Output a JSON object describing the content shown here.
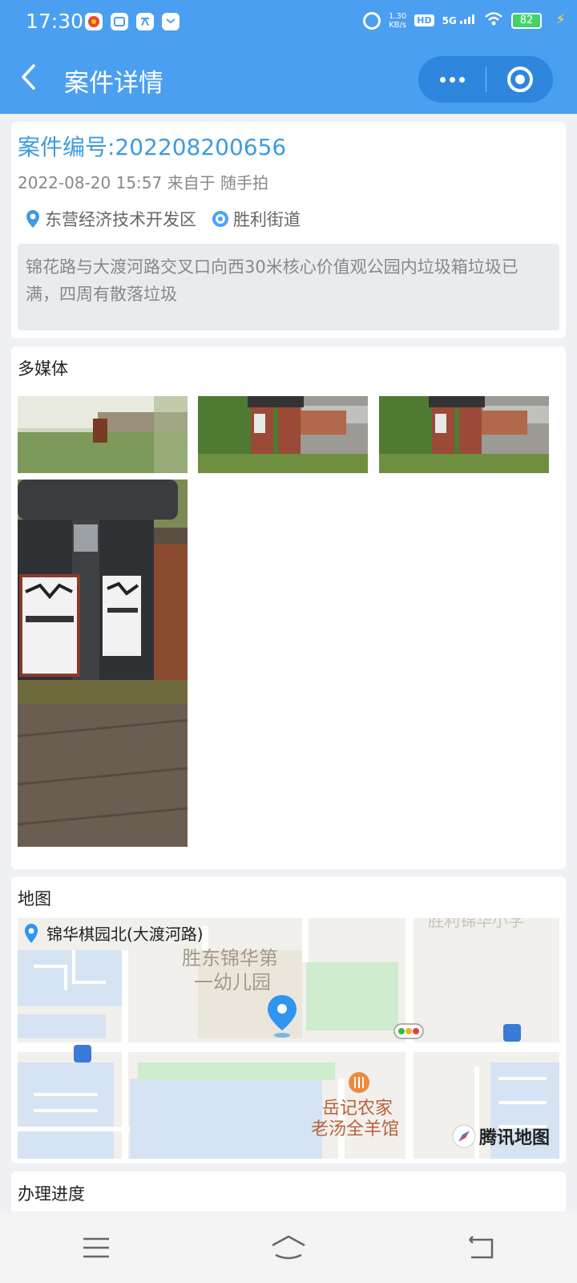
{
  "status_bar": {
    "time": "17:30",
    "net_speed_value": "1.30",
    "net_speed_unit": "KB/s",
    "hd_label": "HD",
    "signal_label": "5G",
    "battery": "82"
  },
  "nav": {
    "back_icon": "chevron-left-icon",
    "title": "案件详情"
  },
  "case": {
    "number_label": "案件编号:202208200656",
    "datetime": "2022-08-20 15:57",
    "source_prefix": "来自于",
    "source": "随手拍",
    "district": "东营经济技术开发区",
    "street": "胜利街道",
    "description": "锦花路与大渡河路交叉口向西30米核心价值观公园内垃圾箱垃圾已满，四周有散落垃圾"
  },
  "media": {
    "title": "多媒体",
    "photos": [
      "photo-1",
      "photo-2",
      "photo-3",
      "photo-4"
    ]
  },
  "map": {
    "title": "地图",
    "location": "锦华棋园北(大渡河路)",
    "poi_school_line1": "胜东锦华第",
    "poi_school_line2": "一幼儿园",
    "poi_top_right": "胜利锦华小学",
    "poi_restaurant_line1": "岳记农家",
    "poi_restaurant_line2": "老汤全羊馆",
    "provider": "腾讯地图"
  },
  "progress": {
    "title": "办理进度"
  },
  "colors": {
    "header": "#4a9ff0",
    "accent": "#3d9be0",
    "pin": "#2f95ef"
  }
}
